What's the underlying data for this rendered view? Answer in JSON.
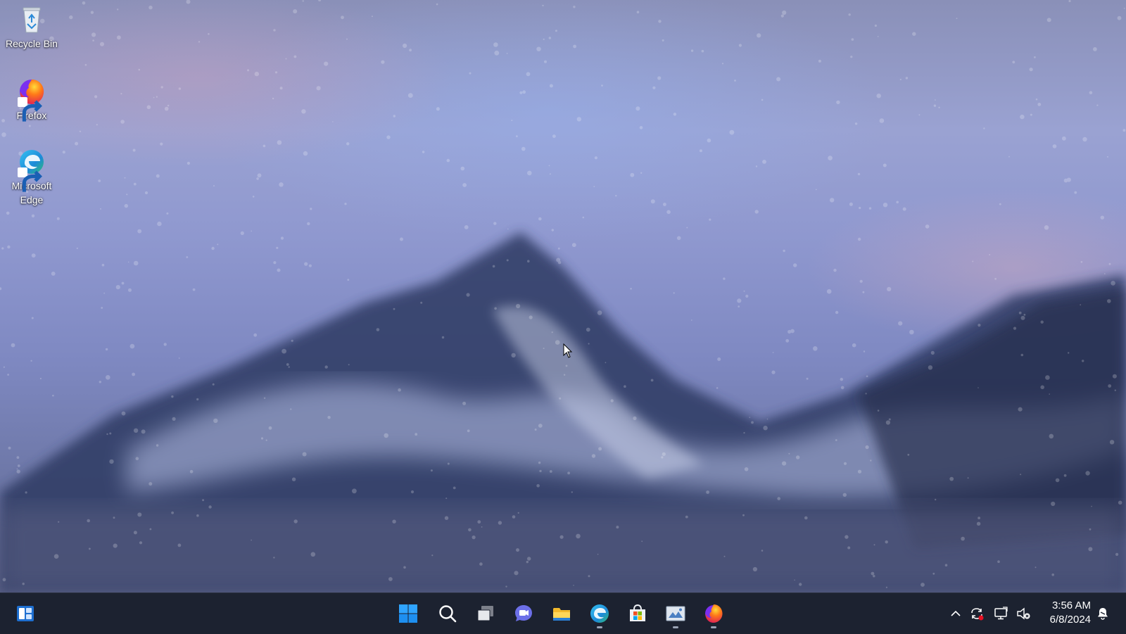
{
  "desktop": {
    "icons": [
      {
        "label": "Recycle Bin",
        "icon": "recycle-bin-icon"
      },
      {
        "label": "Firefox",
        "icon": "firefox-icon"
      },
      {
        "label": "Microsoft Edge",
        "icon": "edge-icon"
      }
    ]
  },
  "taskbar": {
    "left": {
      "icon": "widgets-icon"
    },
    "apps": [
      {
        "icon": "start-icon",
        "running": false
      },
      {
        "icon": "search-icon",
        "running": false
      },
      {
        "icon": "task-view-icon",
        "running": false
      },
      {
        "icon": "chat-icon",
        "running": false
      },
      {
        "icon": "file-explorer-icon",
        "running": false
      },
      {
        "icon": "edge-icon",
        "running": true
      },
      {
        "icon": "store-icon",
        "running": false
      },
      {
        "icon": "image-viewer-icon",
        "running": true
      },
      {
        "icon": "firefox-icon",
        "running": true
      }
    ],
    "tray": {
      "icons": [
        "chevron-up-icon",
        "sync-icon",
        "display-icon",
        "volume-muted-icon"
      ],
      "time": "3:56 AM",
      "date": "6/8/2024",
      "notification_icon": "notification-bell-icon"
    }
  },
  "colors": {
    "taskbar_bg": "#1c2230",
    "accent": "#0078d4"
  }
}
